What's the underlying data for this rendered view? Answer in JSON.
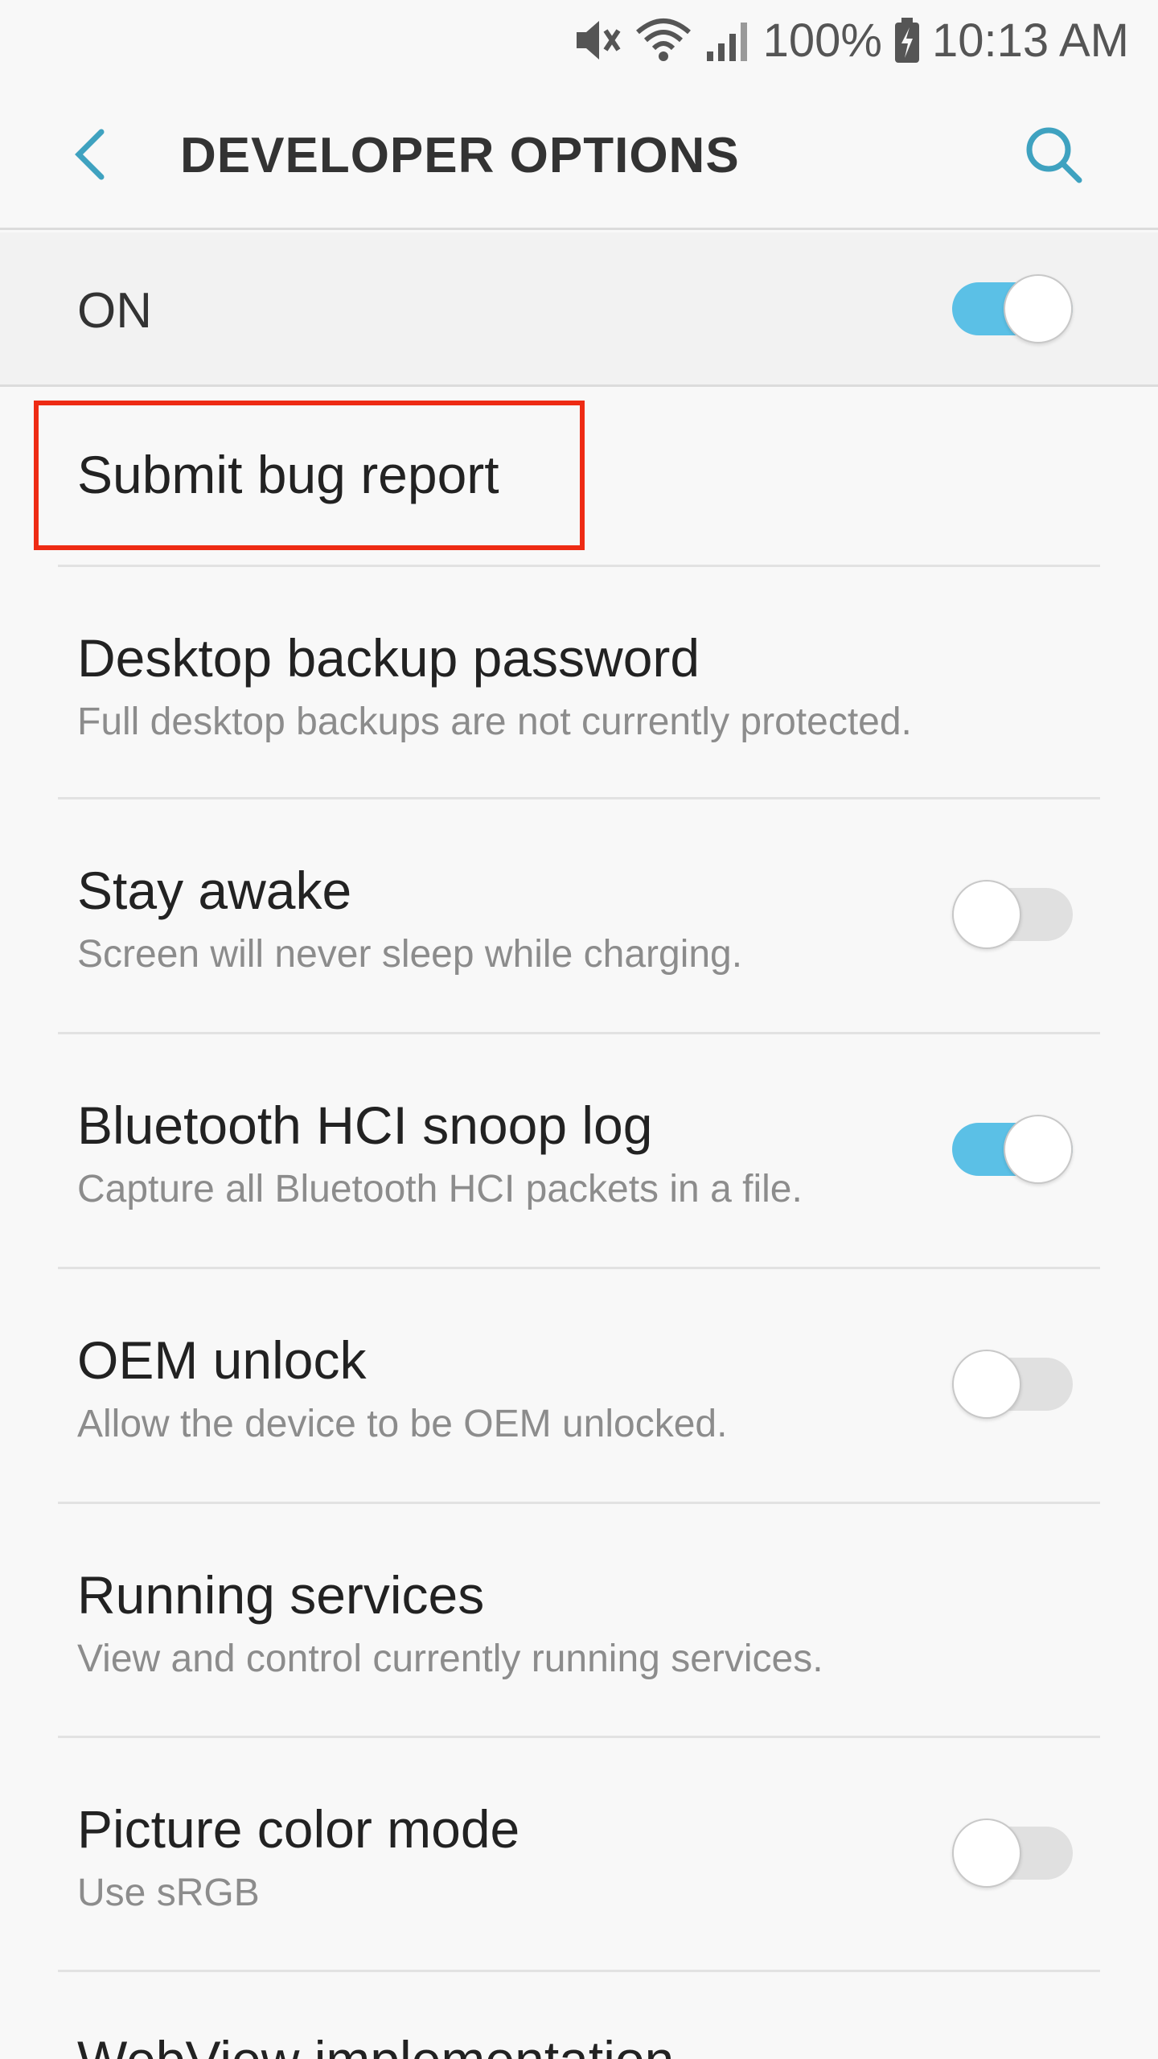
{
  "status_bar": {
    "battery": "100%",
    "time": "10:13 AM",
    "icons": [
      "mute-icon",
      "wifi-icon",
      "signal-icon",
      "battery-charging-icon"
    ]
  },
  "app_bar": {
    "title": "DEVELOPER OPTIONS",
    "back_icon": "back-chevron-icon",
    "search_icon": "search-icon"
  },
  "master": {
    "label": "ON",
    "checked": true
  },
  "items": [
    {
      "title": "Submit bug report",
      "subtitle": ""
    },
    {
      "title": "Desktop backup password",
      "subtitle": "Full desktop backups are not currently protected."
    },
    {
      "title": "Stay awake",
      "subtitle": "Screen will never sleep while charging.",
      "toggle": false
    },
    {
      "title": "Bluetooth HCI snoop log",
      "subtitle": "Capture all Bluetooth HCI packets in a file.",
      "toggle": true
    },
    {
      "title": "OEM unlock",
      "subtitle": "Allow the device to be OEM unlocked.",
      "toggle": false
    },
    {
      "title": "Running services",
      "subtitle": "View and control currently running services."
    },
    {
      "title": "Picture color mode",
      "subtitle": "Use sRGB",
      "toggle": false
    },
    {
      "title": "WebView implementation",
      "subtitle": ""
    }
  ],
  "colors": {
    "accent": "#5bc0e6",
    "back_icon": "#3fa2c0",
    "highlight": "#ee2b14",
    "background": "#f8f8f8"
  }
}
